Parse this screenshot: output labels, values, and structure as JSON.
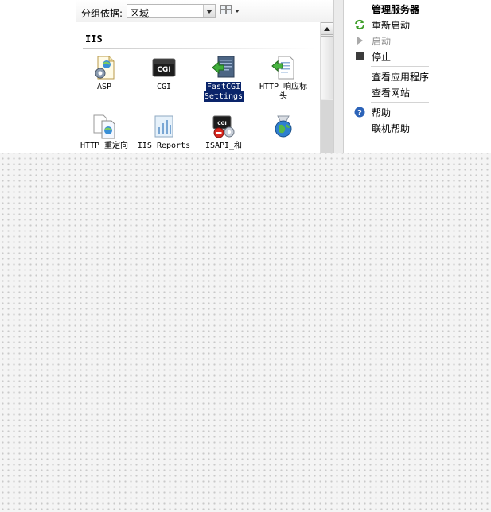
{
  "toolbar": {
    "group_by_label": "分组依据:",
    "group_by_value": "区域",
    "view_icon": "view-icons-icon"
  },
  "features": {
    "group_header": "IIS",
    "items": [
      {
        "label": "ASP",
        "icon": "asp-icon",
        "selected": false
      },
      {
        "label": "CGI",
        "icon": "cgi-icon",
        "selected": false
      },
      {
        "label": "FastCGI Settings",
        "line1": "FastCGI",
        "line2": "Settings",
        "icon": "fastcgi-settings-icon",
        "selected": true
      },
      {
        "label": "HTTP 响应标头",
        "line1": "HTTP 响应标",
        "line2": "头",
        "icon": "http-response-headers-icon",
        "selected": false
      },
      {
        "label": "HTTP 重定向",
        "icon": "http-redirect-icon",
        "selected": false
      },
      {
        "label": "IIS Reports",
        "icon": "iis-reports-icon",
        "selected": false
      },
      {
        "label": "ISAPI_和",
        "icon": "isapi-cgi-restrictions-icon",
        "selected": false
      },
      {
        "label": "",
        "icon": "globe-icon",
        "selected": false
      }
    ]
  },
  "actions": {
    "manage_server_title": "管理服务器",
    "restart": "重新启动",
    "start": "启动",
    "stop": "停止",
    "view_app_pools": "查看应用程序",
    "view_sites": "查看网站",
    "help": "帮助",
    "online_help": "联机帮助"
  },
  "colors": {
    "selection": "#0a246a",
    "restart_green": "#3f9e2a",
    "help_blue": "#2c63b8",
    "disabled_text": "#8e8e8e"
  }
}
